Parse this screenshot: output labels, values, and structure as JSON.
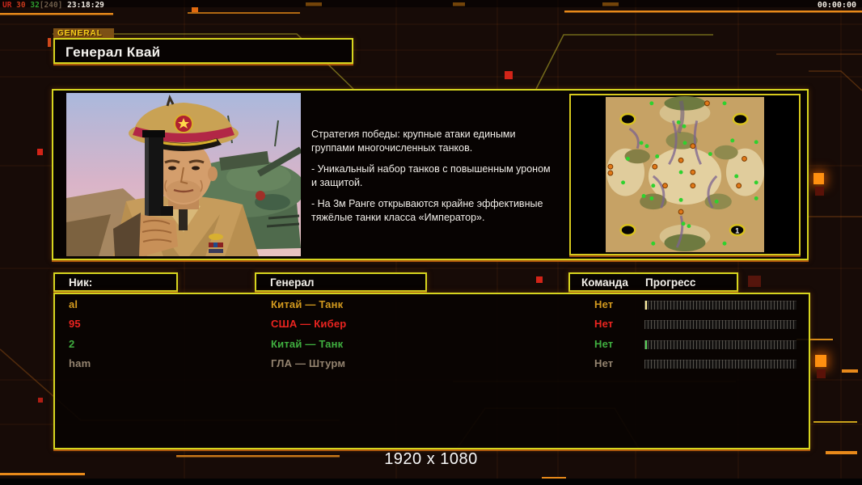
{
  "debug": {
    "parts": [
      {
        "text": "UR",
        "color": "#c8281c"
      },
      {
        "text": " 30",
        "color": "#c83a1c"
      },
      {
        "text": " 32",
        "color": "#2f9e2f"
      },
      {
        "text": "[240]",
        "color": "#6e5c49"
      },
      {
        "text": " 23:18:29",
        "color": "#efe9e0"
      }
    ]
  },
  "clock": {
    "elapsed": "00:00:00"
  },
  "general_panel": {
    "tab_label": "GENERAL",
    "title": "Генерал Квай",
    "description": [
      "Стратегия победы: крупные атаки едиными\n группами многочисленных танков.",
      "- Уникальный набор танков с повышенным уроном\n и защитой.",
      "- На 3м Ранге открываются крайне эффективные\n тяжёлые танки класса «Император»."
    ]
  },
  "minimap": {
    "start_label": "1"
  },
  "lobby": {
    "headers": {
      "nick": "Ник:",
      "general": "Генерал",
      "team": "Команда",
      "progress": "Прогресс"
    },
    "players": [
      {
        "nick": "al",
        "general": "Китай — Танк",
        "team": "Нет",
        "color": "#d2991e",
        "progress_color": "#ffef9e"
      },
      {
        "nick": "95",
        "general": "США — Кибер",
        "team": "Нет",
        "color": "#ea2420",
        "progress_color": null
      },
      {
        "nick": "2",
        "general": "Китай — Танк",
        "team": "Нет",
        "color": "#3fae3f",
        "progress_color": "#58d058"
      },
      {
        "nick": "ham",
        "general": "ГЛА — Штурм",
        "team": "Нет",
        "color": "#93836f",
        "progress_color": null
      }
    ]
  },
  "footer": {
    "resolution": "1920 x 1080"
  },
  "colors": {
    "border_yellow": "#d6d51f",
    "accent_orange": "#e8891a",
    "background": "#170b07"
  }
}
